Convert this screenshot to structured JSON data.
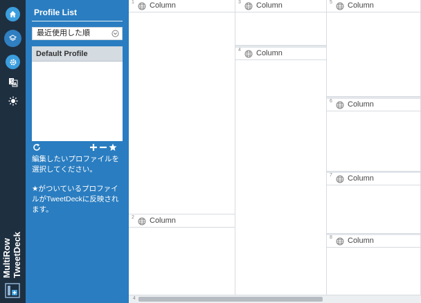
{
  "rail": {
    "brand_line1": "MultiRow",
    "brand_line2": "TweetDeck",
    "icons": [
      "home-icon",
      "layers-icon",
      "gear-icon",
      "translate-icon",
      "brightness-icon"
    ]
  },
  "panel": {
    "title": "Profile List",
    "sort_value": "最近使用した順",
    "profiles": [
      "Default Profile"
    ],
    "help_text_1": "編集したいプロファイルを選択してください。",
    "help_text_2": "★がついているプロファイルがTweetDeckに反映されます。"
  },
  "columns": [
    {
      "number": "1",
      "title": "Column"
    },
    {
      "number": "2",
      "title": "Column"
    },
    {
      "number": "3",
      "title": "Column"
    },
    {
      "number": "4",
      "title": "Column"
    },
    {
      "number": "5",
      "title": "Column"
    },
    {
      "number": "6",
      "title": "Column"
    },
    {
      "number": "7",
      "title": "Column"
    },
    {
      "number": "8",
      "title": "Column"
    }
  ],
  "scrollbar": {
    "number": "4"
  },
  "colors": {
    "rail_bg": "#1e2f40",
    "panel_bg": "#2a7dc0",
    "accent": "#3b9ede"
  }
}
